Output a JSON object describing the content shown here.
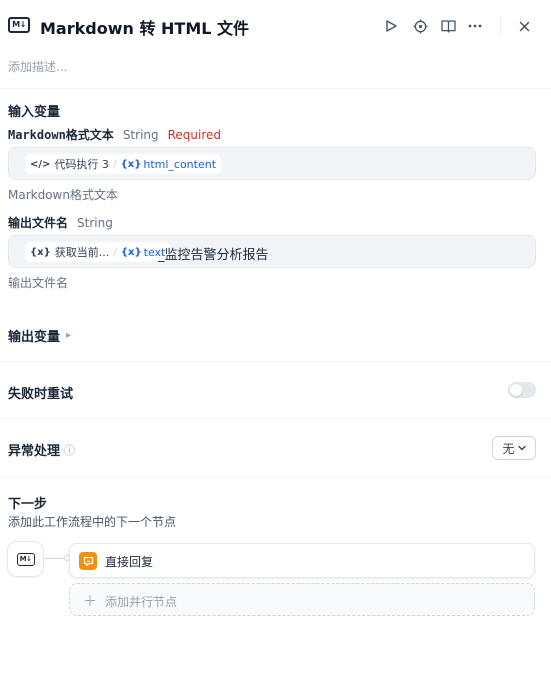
{
  "header": {
    "icon_text": "M↓",
    "title": "Markdown 转 HTML 文件",
    "actions": [
      "run-icon",
      "locate-icon",
      "book-icon",
      "more-icon"
    ],
    "close": "close-icon"
  },
  "description_placeholder": "添加描述...",
  "inputs": {
    "section_title": "输入变量",
    "fields": [
      {
        "name": "Markdown格式文本",
        "type": "String",
        "required": "Required",
        "chip_source": "代码执行 3",
        "chip_sep": "/",
        "chip_var": "html_content",
        "chip_source_icon": "</>",
        "chip_var_icon": "{x}",
        "hint": "Markdown格式文本"
      },
      {
        "name": "输出文件名",
        "type": "String",
        "chip_source": "获取当前...",
        "chip_sep": "/",
        "chip_var": "text",
        "chip_source_icon": "{x}",
        "chip_var_icon": "{x}",
        "suffix_text": "_监控告警分析报告",
        "hint": "输出文件名"
      }
    ]
  },
  "outputs": {
    "section_title": "输出变量",
    "chevron": "▸"
  },
  "retry": {
    "label": "失败时重试",
    "enabled": false
  },
  "error_handling": {
    "label": "异常处理",
    "info_icon": "ⓘ",
    "value": "无",
    "chevron": "⌄"
  },
  "next_step": {
    "title": "下一步",
    "subtitle": "添加此工作流程中的下一个节点",
    "next_node_label": "直接回复",
    "add_parallel_label": "添加并行节点",
    "add_icon": "＋"
  },
  "colors": {
    "required": "#d92d20",
    "variable": "#155eef",
    "reply_node": "#f79009"
  }
}
